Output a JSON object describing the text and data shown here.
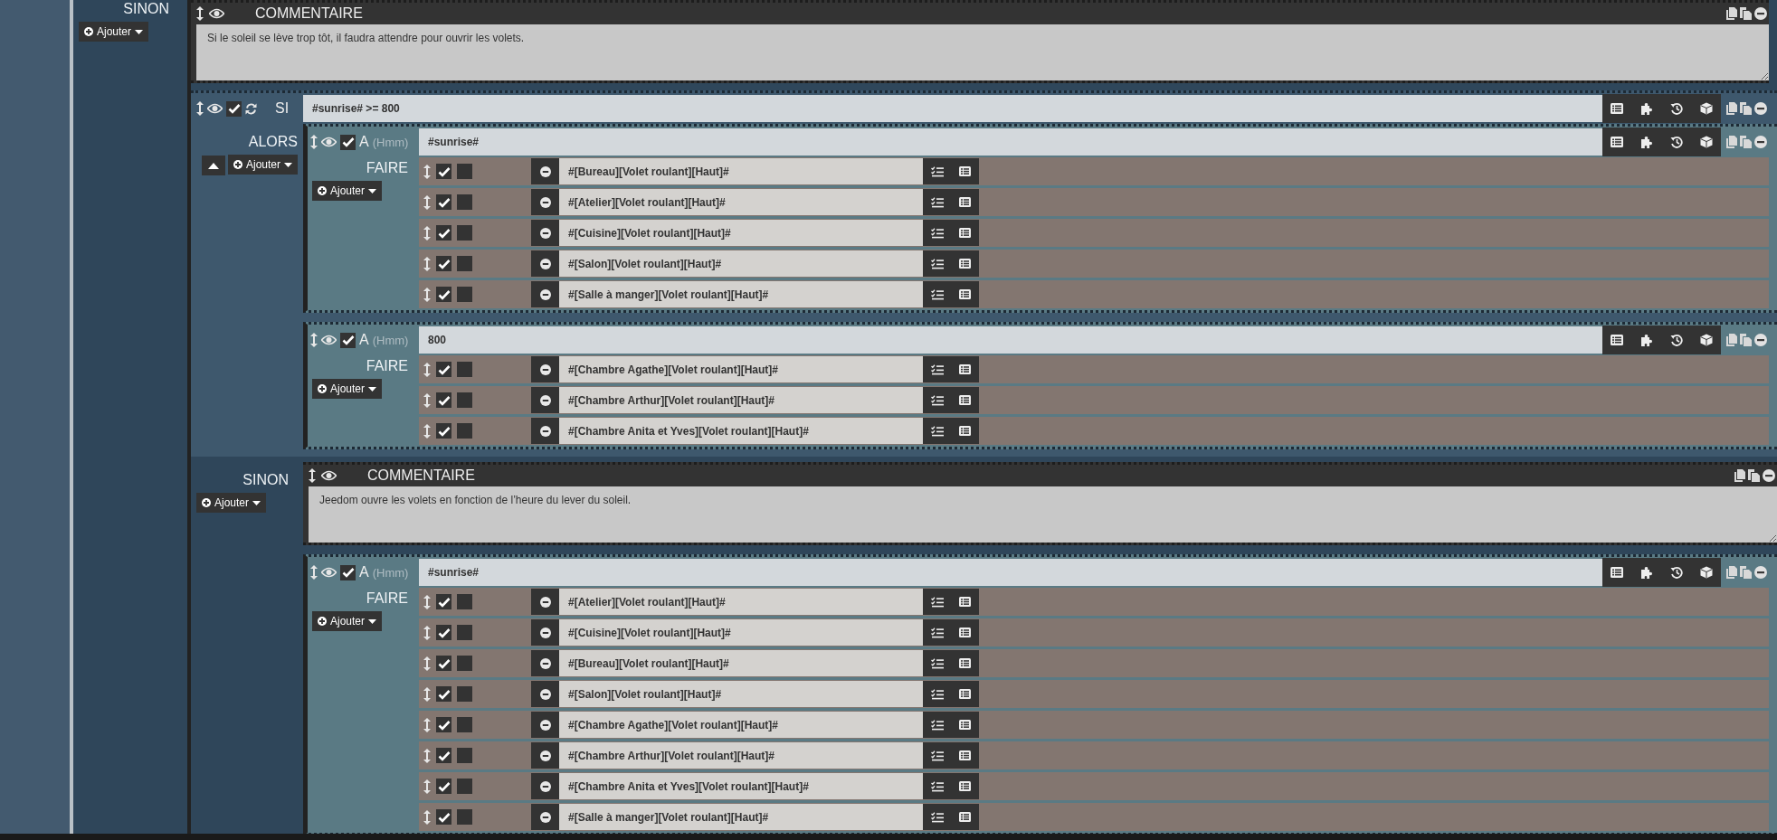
{
  "top_else": {
    "label": "SINON",
    "add_button": "Ajouter",
    "items": [
      {
        "kind": "comment",
        "title": "COMMENTAIRE",
        "text": "Si le soleil se lève trop tôt, il faudra attendre pour ouvrir les volets."
      }
    ]
  },
  "if_block": {
    "keyword": "SI",
    "enabled": true,
    "condition": "#sunrise# >= 800",
    "then_label": "ALORS",
    "then_add_button": "Ajouter",
    "then_items": [
      {
        "kind": "at",
        "keyword": "A",
        "hint": "(Hmm)",
        "enabled": true,
        "value": "#sunrise#",
        "do_label": "FAIRE",
        "add_button": "Ajouter",
        "actions": [
          {
            "enabled": true,
            "parallel": false,
            "command": "#[Bureau][Volet roulant][Haut]#"
          },
          {
            "enabled": true,
            "parallel": false,
            "command": "#[Atelier][Volet roulant][Haut]#"
          },
          {
            "enabled": true,
            "parallel": false,
            "command": "#[Cuisine][Volet roulant][Haut]#"
          },
          {
            "enabled": true,
            "parallel": false,
            "command": "#[Salon][Volet roulant][Haut]#"
          },
          {
            "enabled": true,
            "parallel": false,
            "command": "#[Salle à manger][Volet roulant][Haut]#"
          }
        ]
      },
      {
        "kind": "at",
        "keyword": "A",
        "hint": "(Hmm)",
        "enabled": true,
        "value": "800",
        "do_label": "FAIRE",
        "add_button": "Ajouter",
        "actions": [
          {
            "enabled": true,
            "parallel": false,
            "command": "#[Chambre Agathe][Volet roulant][Haut]#"
          },
          {
            "enabled": true,
            "parallel": false,
            "command": "#[Chambre Arthur][Volet roulant][Haut]#"
          },
          {
            "enabled": true,
            "parallel": false,
            "command": "#[Chambre Anita et Yves][Volet roulant][Haut]#"
          }
        ]
      }
    ],
    "else_label": "SINON",
    "else_add_button": "Ajouter",
    "else_items": [
      {
        "kind": "comment",
        "title": "COMMENTAIRE",
        "text": "Jeedom ouvre les volets en fonction de l’heure du lever du soleil."
      },
      {
        "kind": "at",
        "keyword": "A",
        "hint": "(Hmm)",
        "enabled": true,
        "value": "#sunrise#",
        "do_label": "FAIRE",
        "add_button": "Ajouter",
        "actions": [
          {
            "enabled": true,
            "parallel": false,
            "command": "#[Atelier][Volet roulant][Haut]#"
          },
          {
            "enabled": true,
            "parallel": false,
            "command": "#[Cuisine][Volet roulant][Haut]#"
          },
          {
            "enabled": true,
            "parallel": false,
            "command": "#[Bureau][Volet roulant][Haut]#"
          },
          {
            "enabled": true,
            "parallel": false,
            "command": "#[Salon][Volet roulant][Haut]#"
          },
          {
            "enabled": true,
            "parallel": false,
            "command": "#[Chambre Agathe][Volet roulant][Haut]#"
          },
          {
            "enabled": true,
            "parallel": false,
            "command": "#[Chambre Arthur][Volet roulant][Haut]#"
          },
          {
            "enabled": true,
            "parallel": false,
            "command": "#[Chambre Anita et Yves][Volet roulant][Haut]#"
          },
          {
            "enabled": true,
            "parallel": false,
            "command": "#[Salle à manger][Volet roulant][Haut]#"
          }
        ]
      }
    ]
  }
}
